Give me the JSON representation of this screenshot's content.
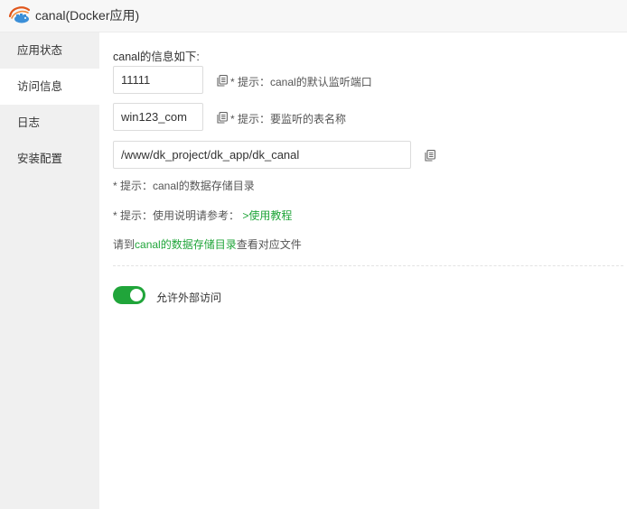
{
  "window": {
    "title": "canal(Docker应用)",
    "logo_icon": "canal-logo-icon"
  },
  "sidebar": {
    "items": [
      {
        "label": "应用状态",
        "active": false
      },
      {
        "label": "访问信息",
        "active": true
      },
      {
        "label": "日志",
        "active": false
      },
      {
        "label": "安装配置",
        "active": false
      }
    ]
  },
  "main": {
    "heading": "canal的信息如下:",
    "port": {
      "value": "11111",
      "hint": "* 提示：canal的默认监听端口"
    },
    "table": {
      "value": "win123_com",
      "hint": "* 提示：要监听的表名称"
    },
    "path": {
      "value": "/www/dk_project/dk_app/dk_canal"
    },
    "path_hint": "* 提示：canal的数据存储目录",
    "usage_hint_prefix": "* 提示：使用说明请参考：",
    "usage_link": ">使用教程",
    "dir_note_prefix": "请到",
    "dir_note_link": "canal的数据存储目录",
    "dir_note_suffix": "查看对应文件",
    "external_access": {
      "label": "允许外部访问",
      "enabled": true
    }
  },
  "colors": {
    "accent": "#20a53a",
    "sidebar_bg": "#f0f0f0",
    "titlebar_bg": "#f7f7f7"
  }
}
